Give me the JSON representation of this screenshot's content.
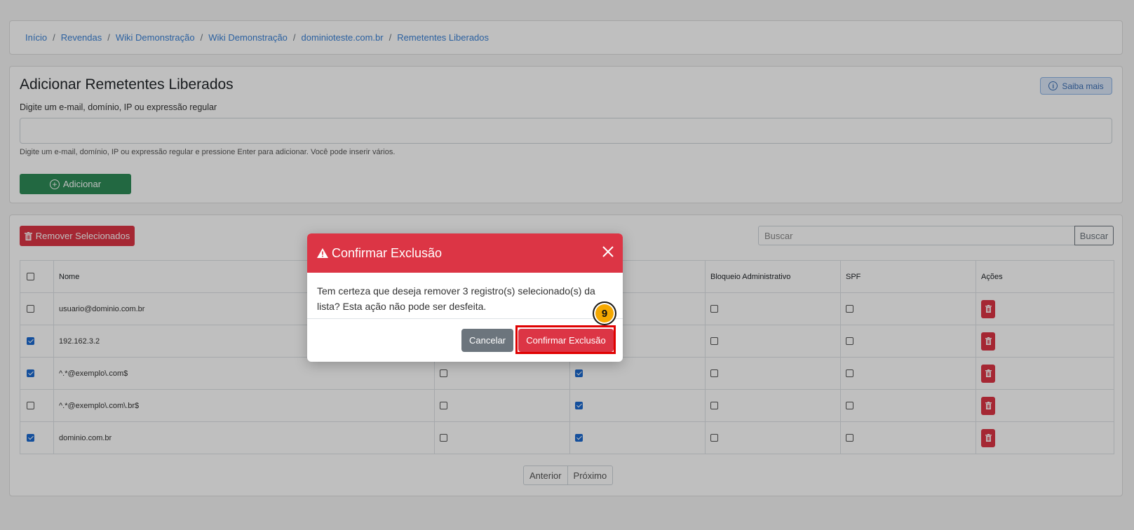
{
  "breadcrumb": [
    "Início",
    "Revendas",
    "Wiki Demonstração",
    "Wiki Demonstração",
    "dominioteste.com.br",
    "Remetentes Liberados"
  ],
  "add_section": {
    "title": "Adicionar Remetentes Liberados",
    "help_label": "Saiba mais",
    "field_label": "Digite um e-mail, domínio, IP ou expressão regular",
    "hint": "Digite um e-mail, domínio, IP ou expressão regular e pressione Enter para adicionar. Você pode inserir vários.",
    "add_button": "Adicionar"
  },
  "list": {
    "remove_selected": "Remover Selecionados",
    "search_placeholder": "Buscar",
    "search_button": "Buscar",
    "columns": [
      "Nome",
      "",
      "",
      "Bloqueio Administrativo",
      "SPF",
      "Ações"
    ],
    "rows": [
      {
        "name": "usuario@dominio.com.br",
        "selected": false,
        "col2": false,
        "col3": false,
        "bloqueio": false,
        "spf": false
      },
      {
        "name": "192.162.3.2",
        "selected": true,
        "col2": false,
        "col3": false,
        "bloqueio": false,
        "spf": false
      },
      {
        "name": "^.*@exemplo\\.com$",
        "selected": true,
        "col2": false,
        "col3": true,
        "bloqueio": false,
        "spf": false
      },
      {
        "name": "^.*@exemplo\\.com\\.br$",
        "selected": false,
        "col2": false,
        "col3": true,
        "bloqueio": false,
        "spf": false
      },
      {
        "name": "dominio.com.br",
        "selected": true,
        "col2": false,
        "col3": true,
        "bloqueio": false,
        "spf": false
      }
    ],
    "pager": {
      "prev": "Anterior",
      "next": "Próximo"
    }
  },
  "modal": {
    "title": "Confirmar Exclusão",
    "body": "Tem certeza que deseja remover 3 registro(s) selecionado(s) da lista? Esta ação não pode ser desfeita.",
    "cancel": "Cancelar",
    "confirm": "Confirmar Exclusão"
  },
  "step_badge": "9",
  "colors": {
    "danger": "#dc3545",
    "success": "#2e8b57",
    "link": "#3b82d6",
    "secondary": "#6c757d",
    "badge": "#f5a800"
  }
}
